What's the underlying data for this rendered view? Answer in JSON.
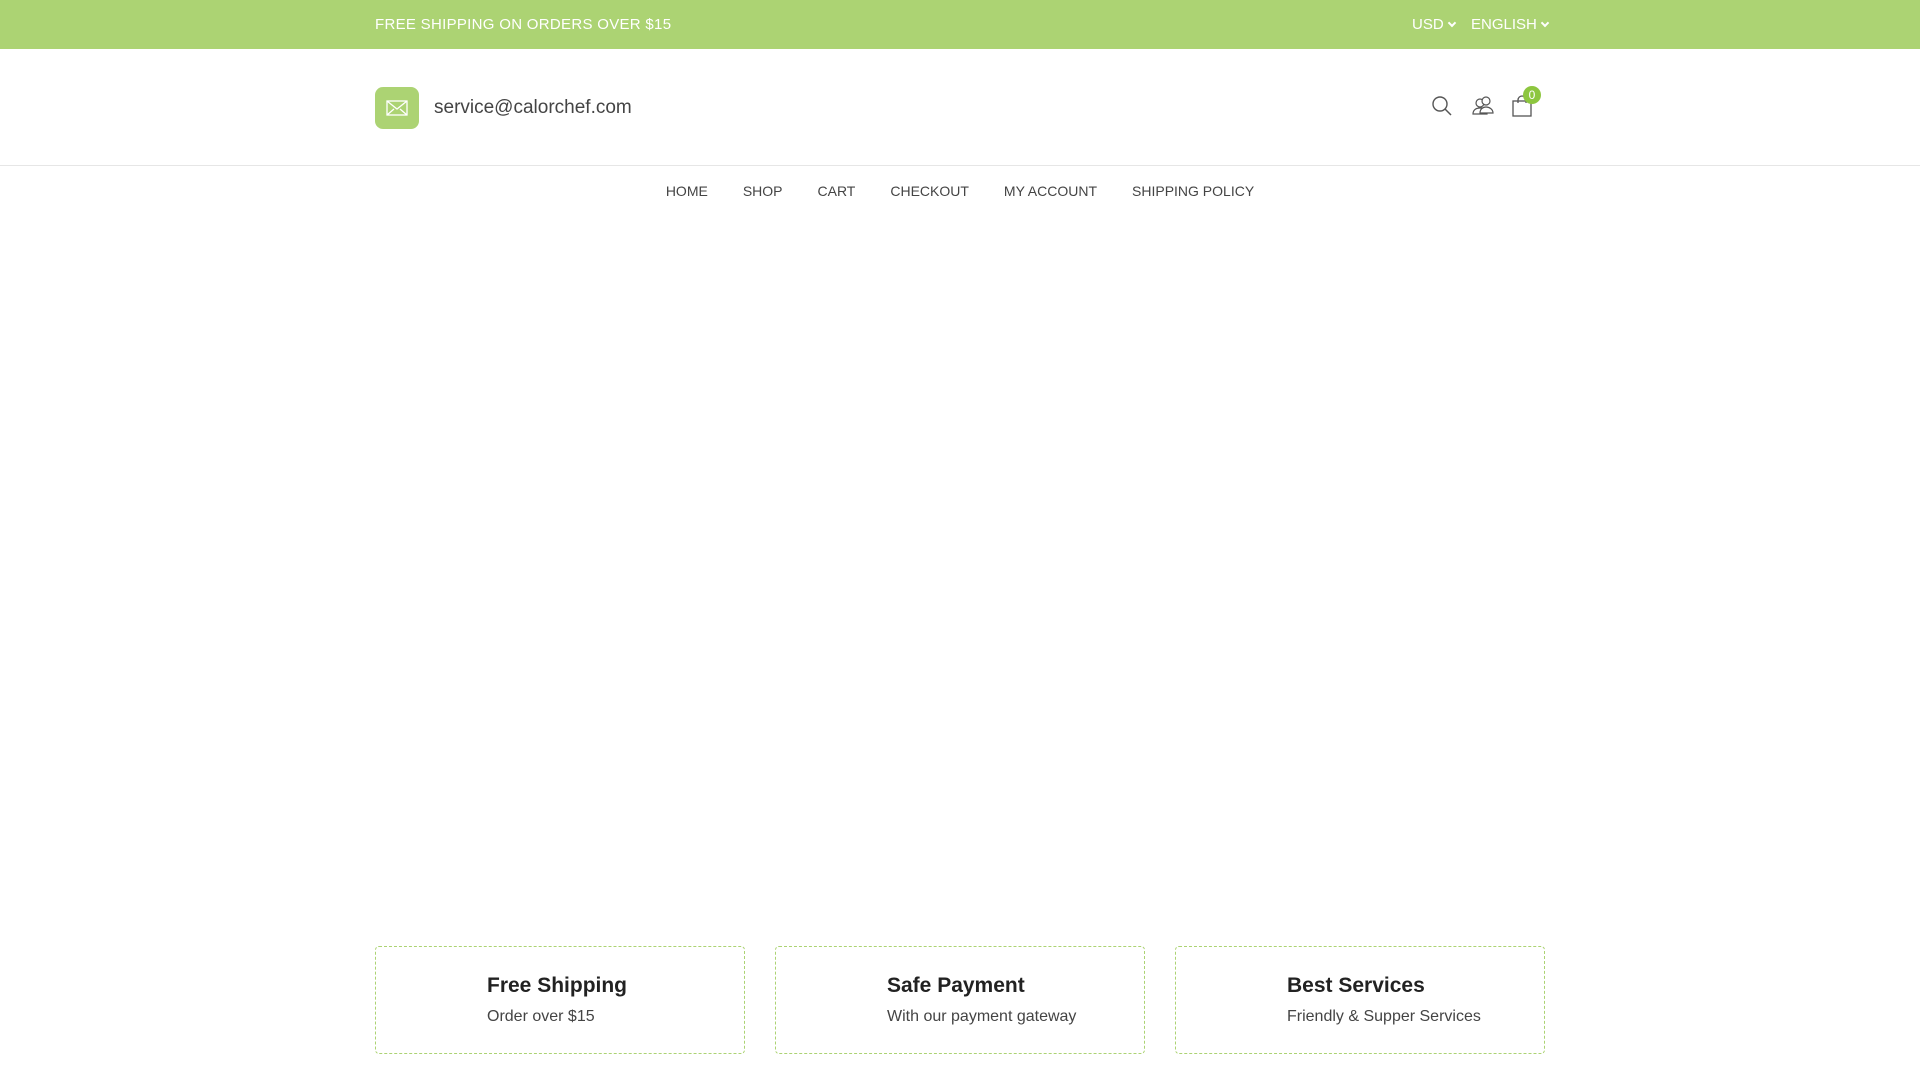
{
  "topbar": {
    "shipping": "FREE SHIPPING ON ORDERS OVER $15",
    "currency": "USD",
    "language": "ENGLISH"
  },
  "header": {
    "email": "service@calorchef.com",
    "cart_count": "0"
  },
  "nav": [
    "HOME",
    "SHOP",
    "CART",
    "CHECKOUT",
    "MY ACCOUNT",
    "SHIPPING POLICY"
  ],
  "features": [
    {
      "title": "Free Shipping",
      "subtitle": "Order over $15"
    },
    {
      "title": "Safe Payment",
      "subtitle": "With our payment gateway"
    },
    {
      "title": "Best Services",
      "subtitle": "Friendly & Supper Services"
    }
  ],
  "colors": {
    "accent": "#acd373"
  }
}
